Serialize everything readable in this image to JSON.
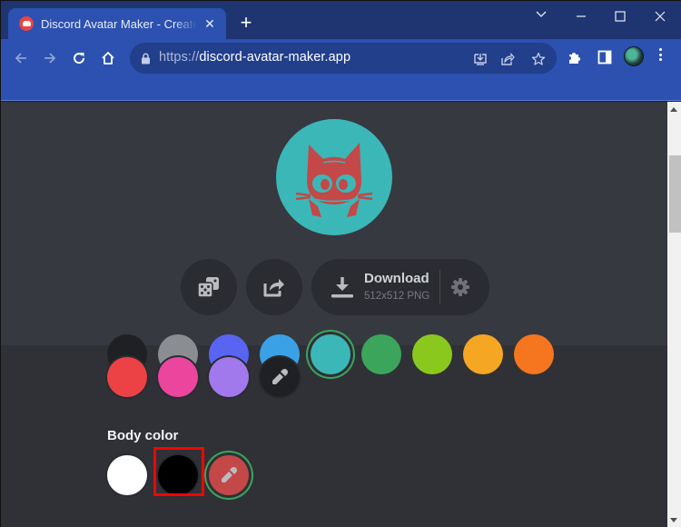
{
  "browser": {
    "tab": {
      "title": "Discord Avatar Maker - Create your own Discord avatar",
      "close_icon": "close-icon",
      "favicon": "discord-favicon"
    },
    "new_tab_label": "+",
    "window_controls": [
      "tab-search",
      "minimize",
      "maximize",
      "close"
    ],
    "url": {
      "scheme": "https://",
      "host": "discord-avatar-maker.app"
    },
    "nav_icons": [
      "back-icon",
      "forward-icon",
      "reload-icon",
      "home-icon"
    ],
    "omnibox_icons": [
      "install-app-icon",
      "share-icon",
      "bookmark-star-icon"
    ],
    "toolbar_icons": [
      "extensions-icon",
      "side-panel-icon",
      "profile-avatar",
      "menu-icon"
    ]
  },
  "preview": {
    "avatar": {
      "background_color": "#3bb7b8",
      "body_color": "#c44848",
      "character": "cat"
    },
    "actions": {
      "randomize_icon": "dice-icon",
      "share_icon": "share-icon",
      "download_label": "Download",
      "download_sub": "512x512 PNG",
      "settings_icon": "gear-icon"
    }
  },
  "editor": {
    "partial_row_colors": [
      "#1f2024",
      "#8a8e93",
      "#5865f2",
      "#3ba1e6",
      "#3bb7b8",
      "#3ba55c",
      "#8bc81d",
      "#f5a623",
      "#f5761e"
    ],
    "selected_partial_index": 4,
    "background_swatches": [
      {
        "name": "red",
        "color": "#ed4245"
      },
      {
        "name": "pink",
        "color": "#eb459e"
      },
      {
        "name": "purple",
        "color": "#a179ec"
      }
    ],
    "background_custom_icon": "eyedropper-icon",
    "body_color": {
      "label": "Body color",
      "swatches": [
        {
          "name": "white",
          "color": "#ffffff"
        },
        {
          "name": "black",
          "color": "#000000"
        }
      ],
      "custom_color": "#c44848",
      "custom_selected": true,
      "custom_icon": "eyedropper-icon"
    },
    "highlight_color": "#ff0000",
    "selected_ring_color": "#3ba55c"
  }
}
